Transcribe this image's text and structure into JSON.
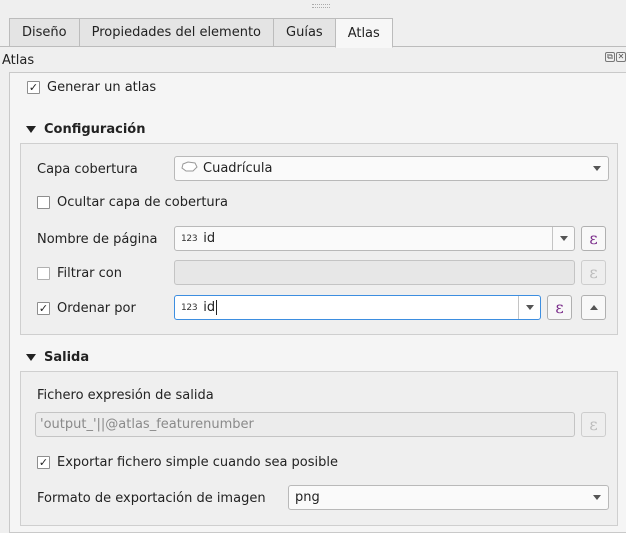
{
  "tabs": [
    "Diseño",
    "Propiedades del elemento",
    "Guías",
    "Atlas"
  ],
  "active_tab": "Atlas",
  "dock": {
    "title": "Atlas"
  },
  "generate_atlas": {
    "label": "Generar un atlas",
    "checked": true
  },
  "config": {
    "title": "Configuración",
    "coverage_label": "Capa cobertura",
    "coverage_value": "Cuadrícula",
    "hide_coverage": {
      "label": "Ocultar capa de cobertura",
      "checked": false
    },
    "page_name_label": "Nombre de página",
    "page_name_type": "123",
    "page_name_value": "id",
    "filter": {
      "label": "Filtrar con",
      "checked": false
    },
    "sort": {
      "label": "Ordenar por",
      "checked": true
    },
    "sort_type": "123",
    "sort_value": "id"
  },
  "output": {
    "title": "Salida",
    "expr_label": "Fichero expresión de salida",
    "expr_value": "'output_'||@atlas_featurenumber",
    "single_file": {
      "label": "Exportar fichero simple cuando sea posible",
      "checked": true
    },
    "format_label": "Formato de exportación de imagen",
    "format_value": "png"
  },
  "icons": {
    "expression": "ε",
    "check": "✓",
    "coverage_layer": "polygon-layer-icon"
  }
}
